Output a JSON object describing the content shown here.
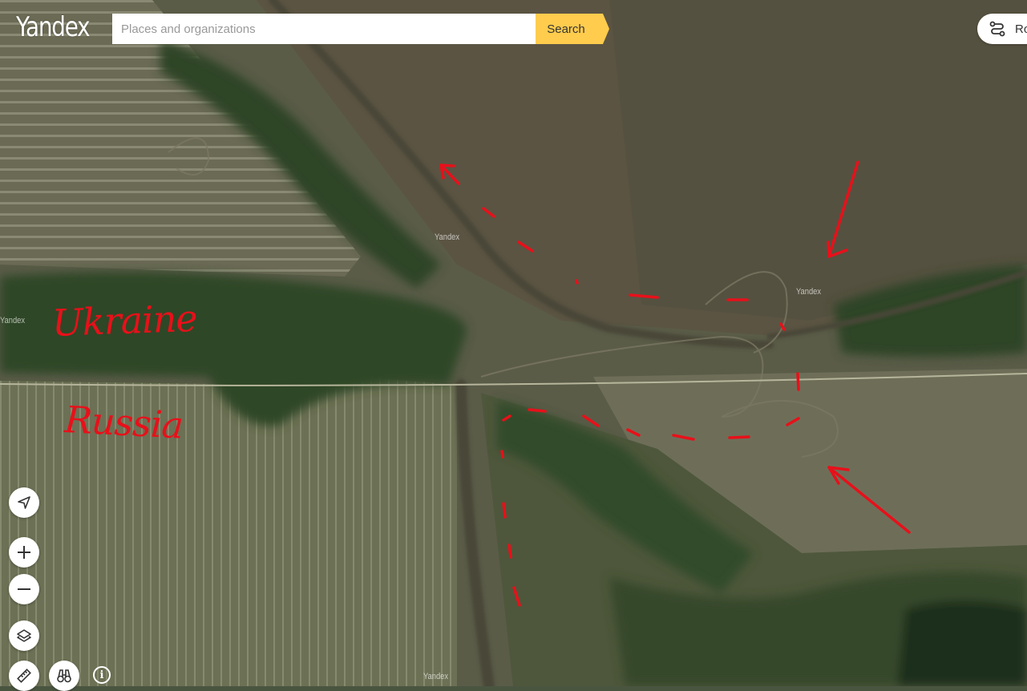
{
  "header": {
    "logo_text": "Yandex",
    "search": {
      "placeholder": "Places and organizations",
      "value": "",
      "button_label": "Search"
    },
    "routes_label": "Ro"
  },
  "map": {
    "view": "satellite",
    "watermark_text": "Yandex",
    "annotations": {
      "ukraine_label": "Ukraine",
      "russia_label": "Russia",
      "color": "#e8101a"
    }
  },
  "controls": [
    {
      "name": "locate-button",
      "icon": "navigation-arrow-icon"
    },
    {
      "name": "zoom-in-button",
      "icon": "plus-icon"
    },
    {
      "name": "zoom-out-button",
      "icon": "minus-icon"
    },
    {
      "name": "layers-button",
      "icon": "layers-icon"
    },
    {
      "name": "ruler-button",
      "icon": "ruler-icon"
    },
    {
      "name": "panorama-button",
      "icon": "binoculars-icon"
    },
    {
      "name": "info-button",
      "icon": "info-icon",
      "text": "i"
    }
  ],
  "colors": {
    "search_button": "#ffcc4d",
    "annotation_red": "#e8101a"
  }
}
